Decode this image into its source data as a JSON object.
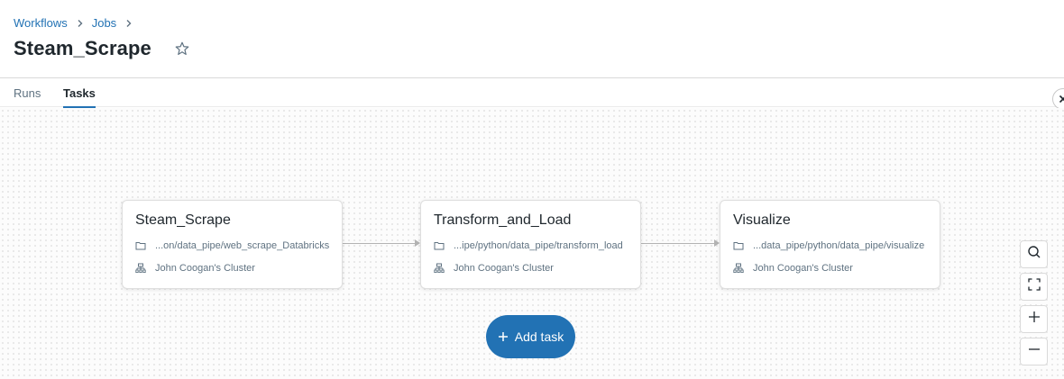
{
  "breadcrumb": {
    "workflows": "Workflows",
    "jobs": "Jobs"
  },
  "page": {
    "title": "Steam_Scrape"
  },
  "tabs": [
    {
      "label": "Runs"
    },
    {
      "label": "Tasks"
    }
  ],
  "nodes": [
    {
      "title": "Steam_Scrape",
      "path": "...on/data_pipe/web_scrape_Databricks",
      "cluster": "John Coogan's Cluster"
    },
    {
      "title": "Transform_and_Load",
      "path": "...ipe/python/data_pipe/transform_load",
      "cluster": "John Coogan's Cluster"
    },
    {
      "title": "Visualize",
      "path": "...data_pipe/python/data_pipe/visualize",
      "cluster": "John Coogan's Cluster"
    }
  ],
  "add_task": {
    "label": "Add task"
  },
  "colors": {
    "accent": "#2272b4",
    "text": "#1f272d",
    "muted": "#5f7281"
  }
}
